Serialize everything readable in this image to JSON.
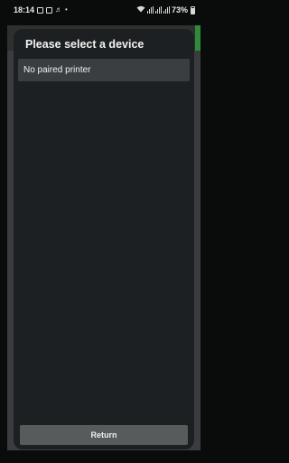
{
  "status_bar": {
    "time": "18:14",
    "left_icons": [
      "image-icon",
      "gallery-icon",
      "mic-icon",
      "dot-icon"
    ],
    "right_icons": [
      "wifi-icon",
      "signal-icon",
      "battery-icon"
    ],
    "battery_percent": "73%",
    "battery_level": 0.73
  },
  "dialog": {
    "title": "Please select a device",
    "items": [
      {
        "label": "No paired printer"
      }
    ],
    "return_label": "Return"
  },
  "colors": {
    "dialog_bg": "#1d2022",
    "item_bg": "#3b3e41",
    "button_bg": "#585b5c",
    "accent": "#2e8b3a"
  }
}
